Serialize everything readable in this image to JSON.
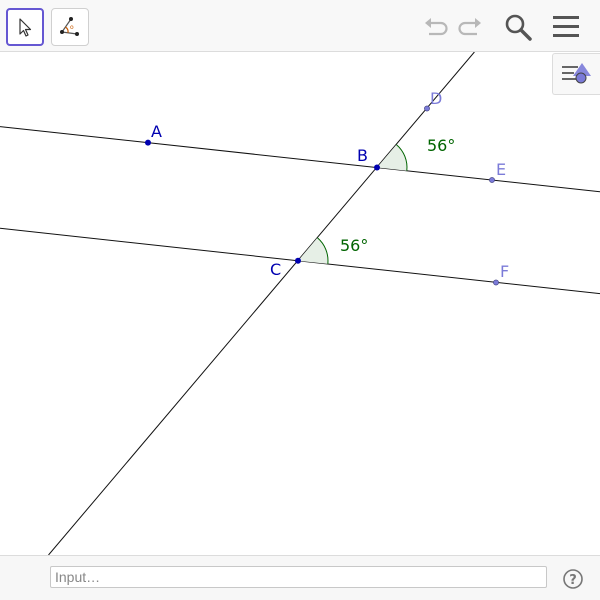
{
  "toolbar": {
    "tools": [
      {
        "name": "move-tool",
        "active": true
      },
      {
        "name": "angle-tool",
        "active": false
      }
    ],
    "icons": [
      "undo-icon",
      "redo-icon",
      "search-icon",
      "menu-icon",
      "style-bar-icon"
    ]
  },
  "construction": {
    "points": [
      {
        "id": "A",
        "label": "A",
        "color": "#0000b0"
      },
      {
        "id": "B",
        "label": "B",
        "color": "#0000b0"
      },
      {
        "id": "C",
        "label": "C",
        "color": "#0000b0"
      },
      {
        "id": "D",
        "label": "D",
        "color": "#7b7bd8"
      },
      {
        "id": "E",
        "label": "E",
        "color": "#7b7bd8"
      },
      {
        "id": "F",
        "label": "F",
        "color": "#7b7bd8"
      }
    ],
    "angles": [
      {
        "id": "angle-at-b",
        "vertex": "B",
        "label": "56°",
        "color": "#006400"
      },
      {
        "id": "angle-at-c",
        "vertex": "C",
        "label": "56°",
        "color": "#006400"
      }
    ],
    "lines": [
      {
        "id": "line-ab",
        "through": [
          "A",
          "B"
        ]
      },
      {
        "id": "line-cf",
        "through": [
          "C",
          "F"
        ]
      },
      {
        "id": "transversal-bc",
        "through": [
          "C",
          "D"
        ]
      }
    ]
  },
  "input_bar": {
    "placeholder": "Input…"
  },
  "help": {
    "label": "?"
  }
}
